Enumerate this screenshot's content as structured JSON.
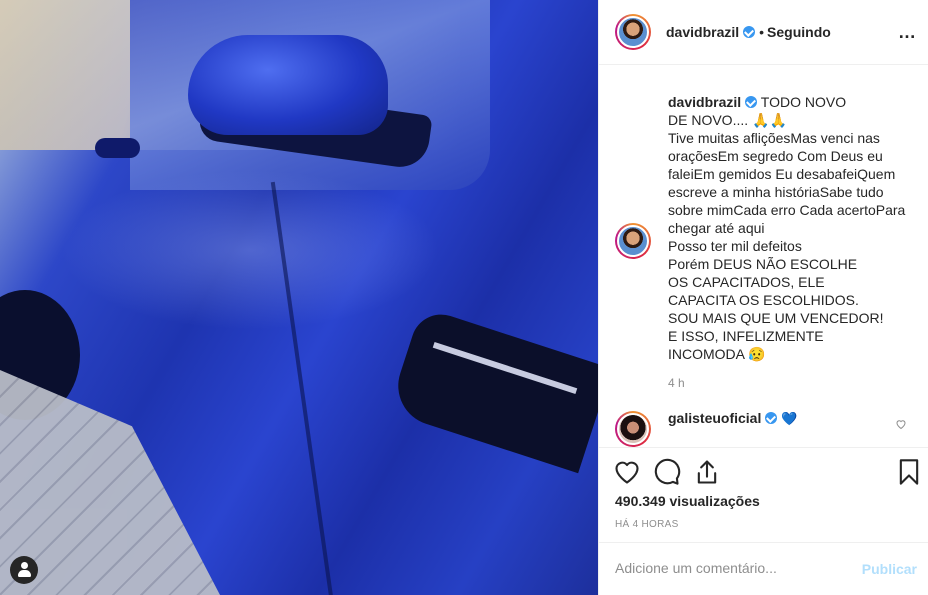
{
  "header": {
    "username": "davidbrazil",
    "separator": "•",
    "follow_status": "Seguindo",
    "more_icon": "…"
  },
  "caption": {
    "username": "davidbrazil",
    "text": " TODO NOVO\nDE NOVO.... 🙏🙏\nTive muitas afliçõesMas venci nas oraçõesEm segredo Com Deus eu faleiEm gemidos Eu desabafeiQuem escreve a minha históriaSabe tudo sobre mimCada erro Cada acertoPara chegar até aqui\nPosso ter mil defeitos\nPorém DEUS NÃO ESCOLHE\nOS CAPACITADOS, ELE\nCAPACITA OS ESCOLHIDOS.\nSOU MAIS QUE UM VENCEDOR!\nE ISSO, INFELIZMENTE\nINCOMODA 😥",
    "time": "4 h"
  },
  "comment": {
    "username": "galisteuoficial",
    "text": "💙"
  },
  "stats": {
    "views": "490.349 visualizações",
    "posted": "HÁ 4 HORAS"
  },
  "add_comment": {
    "placeholder": "Adicione um comentário...",
    "publish_label": "Publicar"
  },
  "colors": {
    "verified": "#3897f0",
    "publish_disabled": "#b2dffc",
    "muted": "#8e8e8e"
  }
}
